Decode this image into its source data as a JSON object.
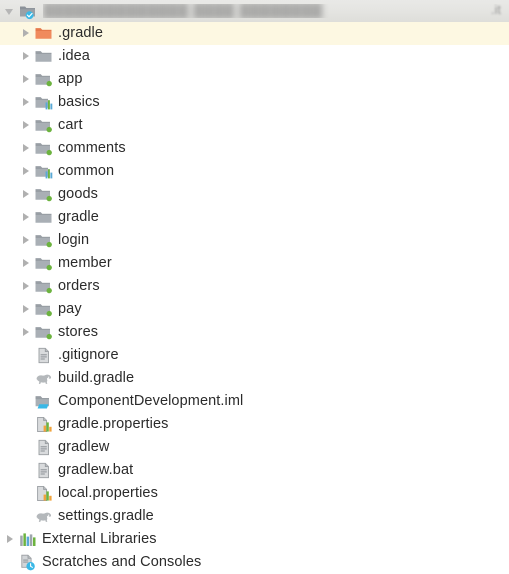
{
  "panel": {
    "name": "project-tree",
    "background": "#ffffff",
    "selection_color": "#fdf8e2",
    "text_color": "#2b2b2b",
    "header_background": "#e6e6e3"
  },
  "header": {
    "twisty": "expanded",
    "icon": "project-folder-icon",
    "project_name_redacted": "██████████████ ████ ████████",
    "project_path_redacted": ".it"
  },
  "tree": [
    {
      "label": ".gradle",
      "indent": 1,
      "twisty": "collapsed",
      "icon": "folder-orange-icon",
      "selected": true
    },
    {
      "label": ".idea",
      "indent": 1,
      "twisty": "collapsed",
      "icon": "folder-gray-icon",
      "selected": false
    },
    {
      "label": "app",
      "indent": 1,
      "twisty": "collapsed",
      "icon": "module-android-icon",
      "selected": false
    },
    {
      "label": "basics",
      "indent": 1,
      "twisty": "collapsed",
      "icon": "module-library-icon",
      "selected": false
    },
    {
      "label": "cart",
      "indent": 1,
      "twisty": "collapsed",
      "icon": "module-android-icon",
      "selected": false
    },
    {
      "label": "comments",
      "indent": 1,
      "twisty": "collapsed",
      "icon": "module-android-icon",
      "selected": false
    },
    {
      "label": "common",
      "indent": 1,
      "twisty": "collapsed",
      "icon": "module-library-icon",
      "selected": false
    },
    {
      "label": "goods",
      "indent": 1,
      "twisty": "collapsed",
      "icon": "module-android-icon",
      "selected": false
    },
    {
      "label": "gradle",
      "indent": 1,
      "twisty": "collapsed",
      "icon": "folder-gray-icon",
      "selected": false
    },
    {
      "label": "login",
      "indent": 1,
      "twisty": "collapsed",
      "icon": "module-android-icon",
      "selected": false
    },
    {
      "label": "member",
      "indent": 1,
      "twisty": "collapsed",
      "icon": "module-android-icon",
      "selected": false
    },
    {
      "label": "orders",
      "indent": 1,
      "twisty": "collapsed",
      "icon": "module-android-icon",
      "selected": false
    },
    {
      "label": "pay",
      "indent": 1,
      "twisty": "collapsed",
      "icon": "module-android-icon",
      "selected": false
    },
    {
      "label": "stores",
      "indent": 1,
      "twisty": "collapsed",
      "icon": "module-android-icon",
      "selected": false
    },
    {
      "label": ".gitignore",
      "indent": 1,
      "twisty": "none",
      "icon": "file-text-icon",
      "selected": false
    },
    {
      "label": "build.gradle",
      "indent": 1,
      "twisty": "none",
      "icon": "gradle-elephant-icon",
      "selected": false
    },
    {
      "label": "ComponentDevelopment.iml",
      "indent": 1,
      "twisty": "none",
      "icon": "iml-module-icon",
      "selected": false
    },
    {
      "label": "gradle.properties",
      "indent": 1,
      "twisty": "none",
      "icon": "file-properties-icon",
      "selected": false
    },
    {
      "label": "gradlew",
      "indent": 1,
      "twisty": "none",
      "icon": "file-text-icon",
      "selected": false
    },
    {
      "label": "gradlew.bat",
      "indent": 1,
      "twisty": "none",
      "icon": "file-text-icon",
      "selected": false
    },
    {
      "label": "local.properties",
      "indent": 1,
      "twisty": "none",
      "icon": "file-properties-icon",
      "selected": false
    },
    {
      "label": "settings.gradle",
      "indent": 1,
      "twisty": "none",
      "icon": "gradle-elephant-icon",
      "selected": false
    },
    {
      "label": "External Libraries",
      "indent": 0,
      "twisty": "collapsed",
      "icon": "external-libraries-icon",
      "selected": false
    },
    {
      "label": "Scratches and Consoles",
      "indent": 0,
      "twisty": "none",
      "icon": "scratches-icon",
      "selected": false
    }
  ]
}
